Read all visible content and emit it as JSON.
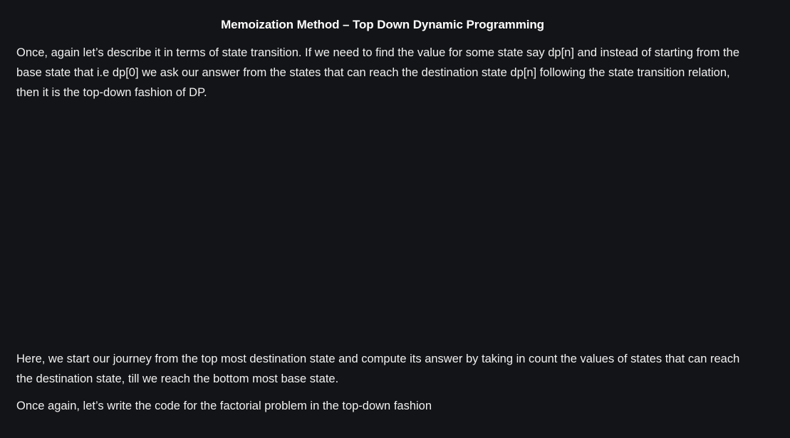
{
  "article": {
    "heading": "Memoization Method – Top Down Dynamic Programming",
    "paragraph_1": "Once, again let’s describe it in terms of state transition. If we need to find the value for some state say dp[n] and instead of starting from the base state that i.e dp[0] we ask our answer from the states that can reach the destination state dp[n] following the state transition relation, then it is the top-down fashion of DP.",
    "paragraph_2": "Here, we start our journey from the top most destination state and compute its answer by taking in count the values of states that can reach the destination state, till we reach the bottom most base state.",
    "paragraph_3": "Once again, let’s write the code for the factorial problem in the top-down fashion"
  },
  "colors": {
    "background": "#131417",
    "text": "#f1f1f1",
    "heading": "#ffffff"
  }
}
